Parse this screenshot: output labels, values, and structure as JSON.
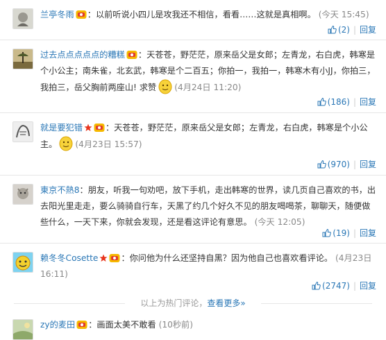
{
  "comments": [
    {
      "user": "兰亭冬雨",
      "text": "以前听说小四儿是攻我还不相信，看看……这就是真相啊。",
      "time": "(今天 15:45)",
      "likes": "(2)",
      "reply": "回复"
    },
    {
      "user": "过去点点点点点的糟糕",
      "text": "天苍苍，野茫茫，原来岳父是女郎；左青龙，右白虎，韩寒是个小公主；南朱雀，北玄武，韩寒是个二百五；你拍一，我拍一，韩寒木有小JJ，你拍三，我拍三，岳父胸前两座山! 求赞",
      "time": "(4月24日 11:20)",
      "likes": "(186)",
      "reply": "回复"
    },
    {
      "user": "就是要犯错",
      "text": "天苍苍，野茫茫，原来岳父是女郎；左青龙，右白虎，韩寒是个小公主。",
      "time": "(4月23日 15:57)",
      "likes": "(970)",
      "reply": "回复"
    },
    {
      "user": "東京不熱8",
      "text": "朋友，听我一句劝吧，放下手机，走出韩寒的世界，读几页自己喜欢的书，出去阳光里走走，要么骑骑自行车，天黑了约几个好久不见的朋友喝喝茶，聊聊天，随便做些什么，一天下来，你就会发现，还是看这评论有意思。",
      "time": "(今天 12:05)",
      "likes": "(19)",
      "reply": "回复"
    },
    {
      "user": "赖冬冬Cosette",
      "text": "你问他为什么还坚持自黑？因为他自己也喜欢看评论。",
      "time": "(4月23日 16:11)",
      "likes": "(2747)",
      "reply": "回复"
    },
    {
      "user": "zy的麦田",
      "text": "画面太美不敢看",
      "time": "(10秒前)"
    }
  ],
  "more_bar": {
    "prefix": "以上为热门评论，",
    "link": "查看更多»"
  },
  "colors": {
    "link": "#2a77b6",
    "muted": "#888888",
    "separator": "#e6e6e6"
  },
  "icons": [
    "member-badge-icon",
    "star-icon",
    "thumbs-up-icon",
    "smiley-emoji-icon"
  ]
}
